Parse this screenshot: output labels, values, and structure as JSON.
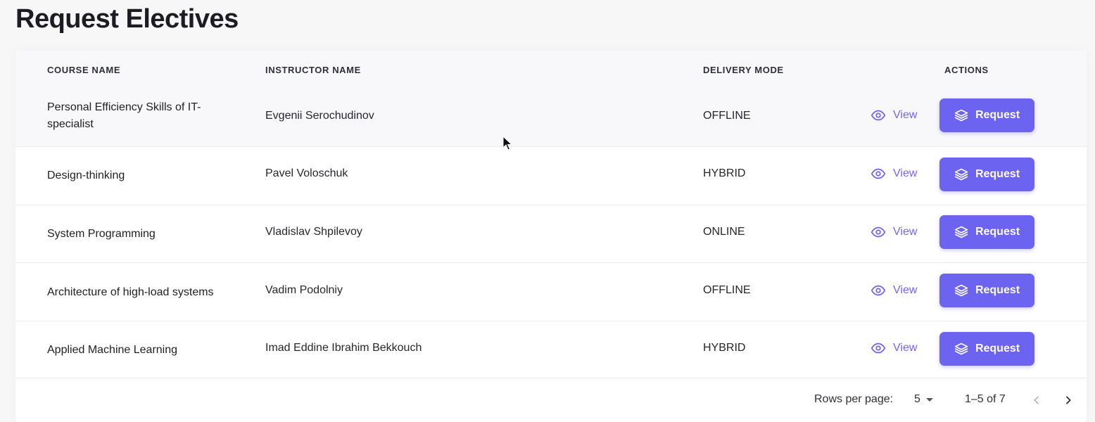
{
  "page": {
    "title": "Request Electives"
  },
  "table": {
    "headers": {
      "course": "COURSE NAME",
      "instructor": "INSTRUCTOR NAME",
      "mode": "DELIVERY MODE",
      "actions": "ACTIONS"
    },
    "rows": [
      {
        "course": "Personal Efficiency Skills of IT-specialist",
        "instructor": "Evgenii Serochudinov",
        "mode": "OFFLINE",
        "view": "View",
        "request": "Request"
      },
      {
        "course": "Design-thinking",
        "instructor": "Pavel Voloschuk",
        "mode": "HYBRID",
        "view": "View",
        "request": "Request"
      },
      {
        "course": "System Programming",
        "instructor": "Vladislav Shpilevoy",
        "mode": "ONLINE",
        "view": "View",
        "request": "Request"
      },
      {
        "course": "Architecture of high-load systems",
        "instructor": "Vadim Podolniy",
        "mode": "OFFLINE",
        "view": "View",
        "request": "Request"
      },
      {
        "course": "Applied Machine Learning",
        "instructor": "Imad Eddine Ibrahim Bekkouch",
        "mode": "HYBRID",
        "view": "View",
        "request": "Request"
      }
    ]
  },
  "pagination": {
    "rows_per_page_label": "Rows per page:",
    "rows_per_page_value": "5",
    "range_text": "1–5 of 7"
  },
  "icons": {
    "view": "eye-icon",
    "request": "layers-icon",
    "prev": "chevron-left-icon",
    "next": "chevron-right-icon",
    "dropdown": "caret-down-icon"
  },
  "colors": {
    "accent": "#6c63f0",
    "link": "#7367f0",
    "prev_disabled": "#b0b0b8",
    "next_enabled": "#2a2a30"
  }
}
